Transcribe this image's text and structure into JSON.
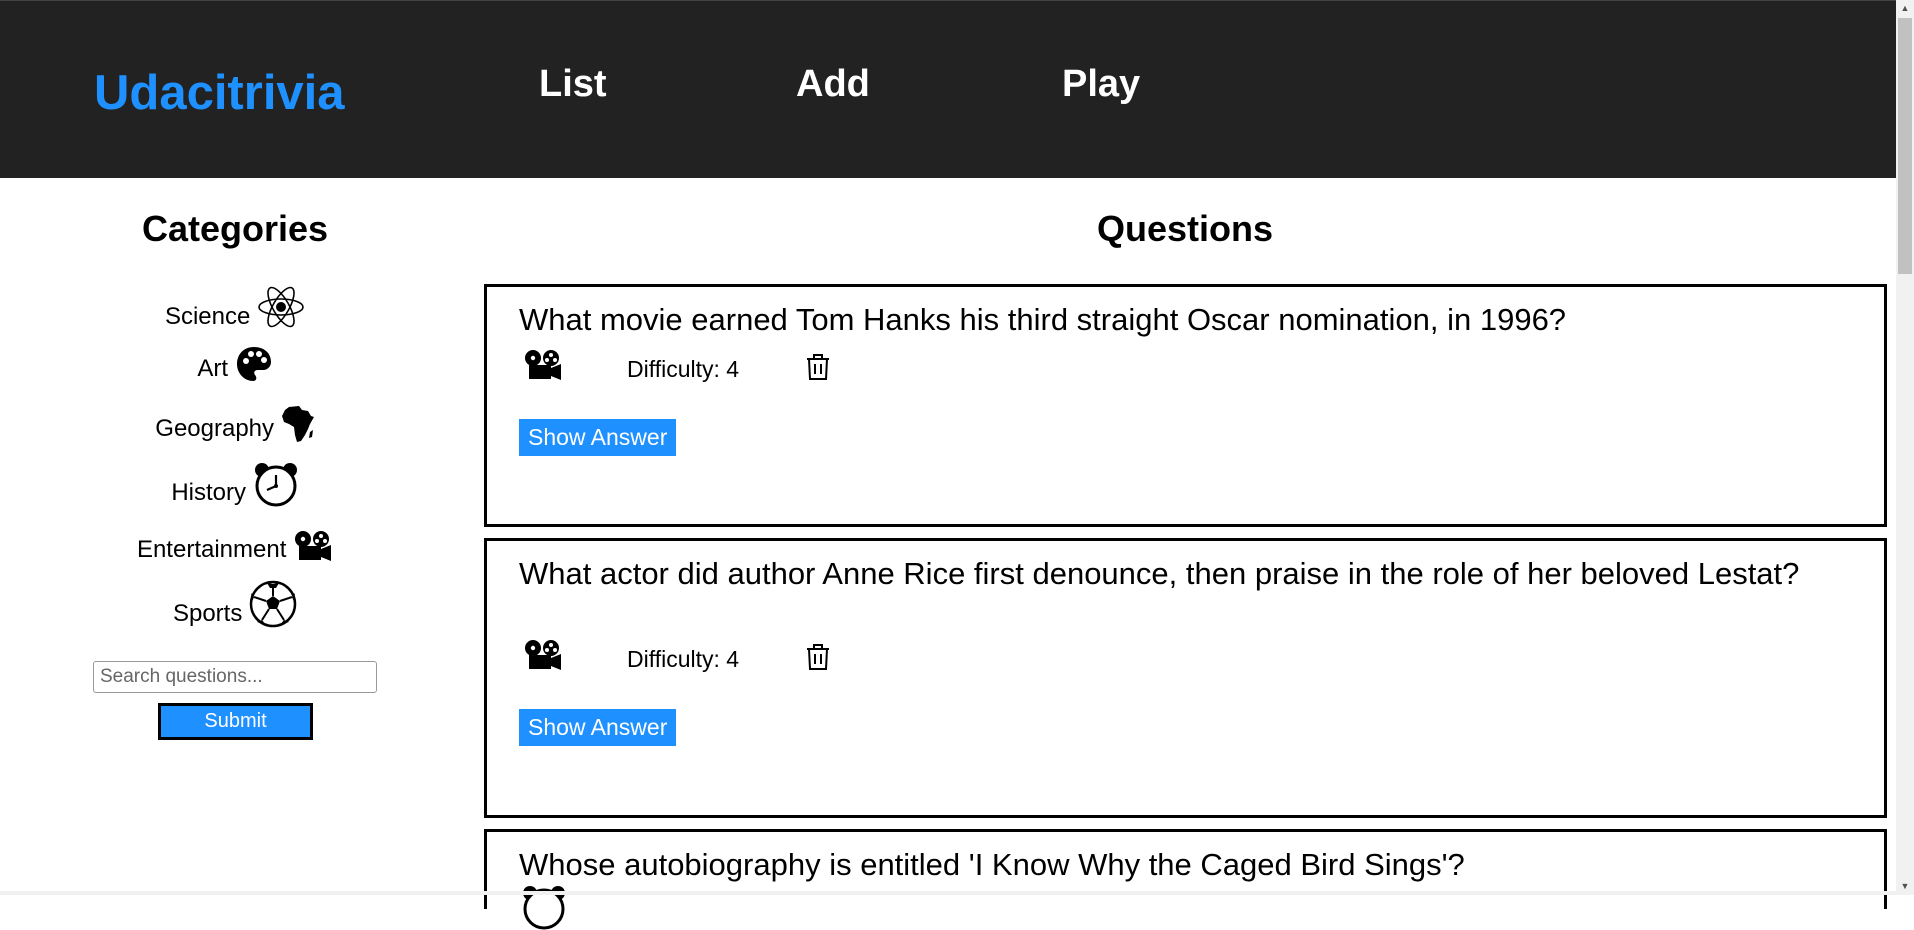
{
  "header": {
    "brand": "Udacitrivia",
    "nav": {
      "list": "List",
      "add": "Add",
      "play": "Play"
    }
  },
  "categories": {
    "title": "Categories",
    "items": [
      {
        "label": "Science",
        "icon": "science-atom-icon"
      },
      {
        "label": "Art",
        "icon": "art-palette-icon"
      },
      {
        "label": "Geography",
        "icon": "geography-africa-icon"
      },
      {
        "label": "History",
        "icon": "history-clock-icon"
      },
      {
        "label": "Entertainment",
        "icon": "entertainment-projector-icon"
      },
      {
        "label": "Sports",
        "icon": "sports-ball-icon"
      }
    ]
  },
  "search": {
    "placeholder": "Search questions...",
    "value": "",
    "submit_label": "Submit"
  },
  "questions": {
    "title": "Questions",
    "items": [
      {
        "text": "What movie earned Tom Hanks his third straight Oscar nomination, in 1996?",
        "difficulty": "Difficulty: 4",
        "category_icon": "entertainment-projector-icon",
        "show_answer_label": "Show Answer"
      },
      {
        "text": "What actor did author Anne Rice first denounce, then praise in the role of her beloved Lestat?",
        "difficulty": "Difficulty: 4",
        "category_icon": "entertainment-projector-icon",
        "show_answer_label": "Show Answer"
      },
      {
        "text": "Whose autobiography is entitled 'I Know Why the Caged Bird Sings'?",
        "category_icon": "history-clock-icon"
      }
    ]
  },
  "colors": {
    "header_bg": "#222222",
    "brand": "#1e90ff",
    "accent": "#1e90ff"
  }
}
